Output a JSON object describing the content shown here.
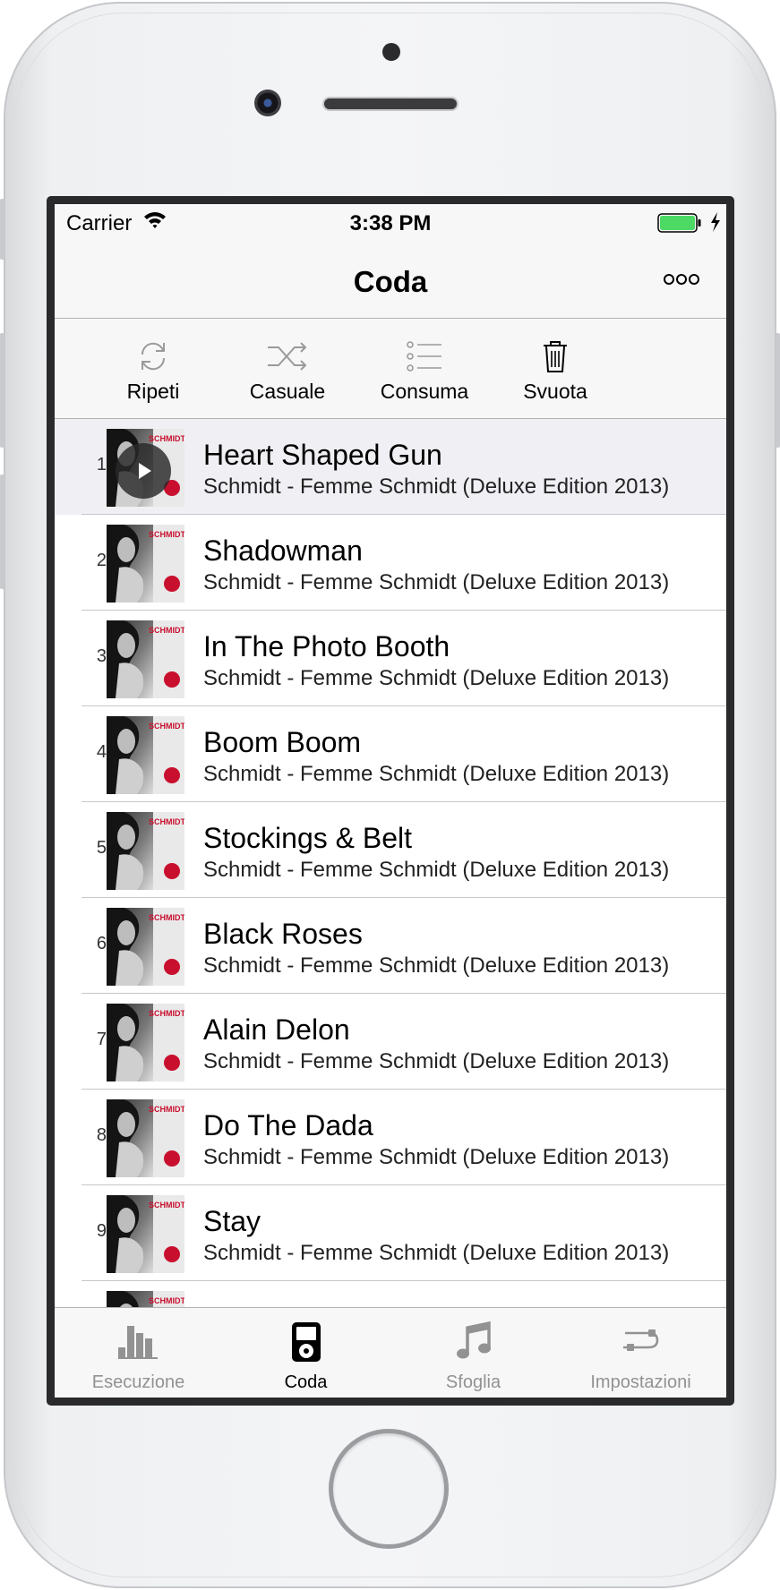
{
  "status_bar": {
    "carrier": "Carrier",
    "time": "3:38 PM"
  },
  "nav": {
    "title": "Coda"
  },
  "toolbar": {
    "repeat_label": "Ripeti",
    "shuffle_label": "Casuale",
    "consume_label": "Consuma",
    "clear_label": "Svuota"
  },
  "queue": [
    {
      "num": "1",
      "title": "Heart Shaped Gun",
      "subtitle": "Schmidt - Femme Schmidt (Deluxe Edition 2013)",
      "playing": true
    },
    {
      "num": "2",
      "title": "Shadowman",
      "subtitle": "Schmidt - Femme Schmidt (Deluxe Edition 2013)"
    },
    {
      "num": "3",
      "title": "In The Photo Booth",
      "subtitle": "Schmidt - Femme Schmidt (Deluxe Edition 2013)"
    },
    {
      "num": "4",
      "title": "Boom Boom",
      "subtitle": "Schmidt - Femme Schmidt (Deluxe Edition 2013)"
    },
    {
      "num": "5",
      "title": "Stockings & Belt",
      "subtitle": "Schmidt - Femme Schmidt (Deluxe Edition 2013)"
    },
    {
      "num": "6",
      "title": "Black Roses",
      "subtitle": "Schmidt - Femme Schmidt (Deluxe Edition 2013)"
    },
    {
      "num": "7",
      "title": "Alain Delon",
      "subtitle": "Schmidt - Femme Schmidt (Deluxe Edition 2013)"
    },
    {
      "num": "8",
      "title": "Do The Dada",
      "subtitle": "Schmidt - Femme Schmidt (Deluxe Edition 2013)"
    },
    {
      "num": "9",
      "title": "Stay",
      "subtitle": "Schmidt - Femme Schmidt (Deluxe Edition 2013)"
    },
    {
      "num": "",
      "title": "",
      "subtitle": ""
    }
  ],
  "tabbar": {
    "tabs": [
      {
        "label": "Esecuzione",
        "icon": "bars-chart-icon"
      },
      {
        "label": "Coda",
        "icon": "ipod-icon",
        "active": true
      },
      {
        "label": "Sfoglia",
        "icon": "music-note-icon"
      },
      {
        "label": "Impostazioni",
        "icon": "cable-icon"
      }
    ]
  },
  "colors": {
    "battery": "#4cd964",
    "bar_background": "#f7f7f7",
    "playing_row": "#efeff4",
    "inactive_tab": "#929292",
    "cover_red": "#c8102e"
  },
  "album_cover": {
    "artist_text": "SCHMIDT"
  }
}
